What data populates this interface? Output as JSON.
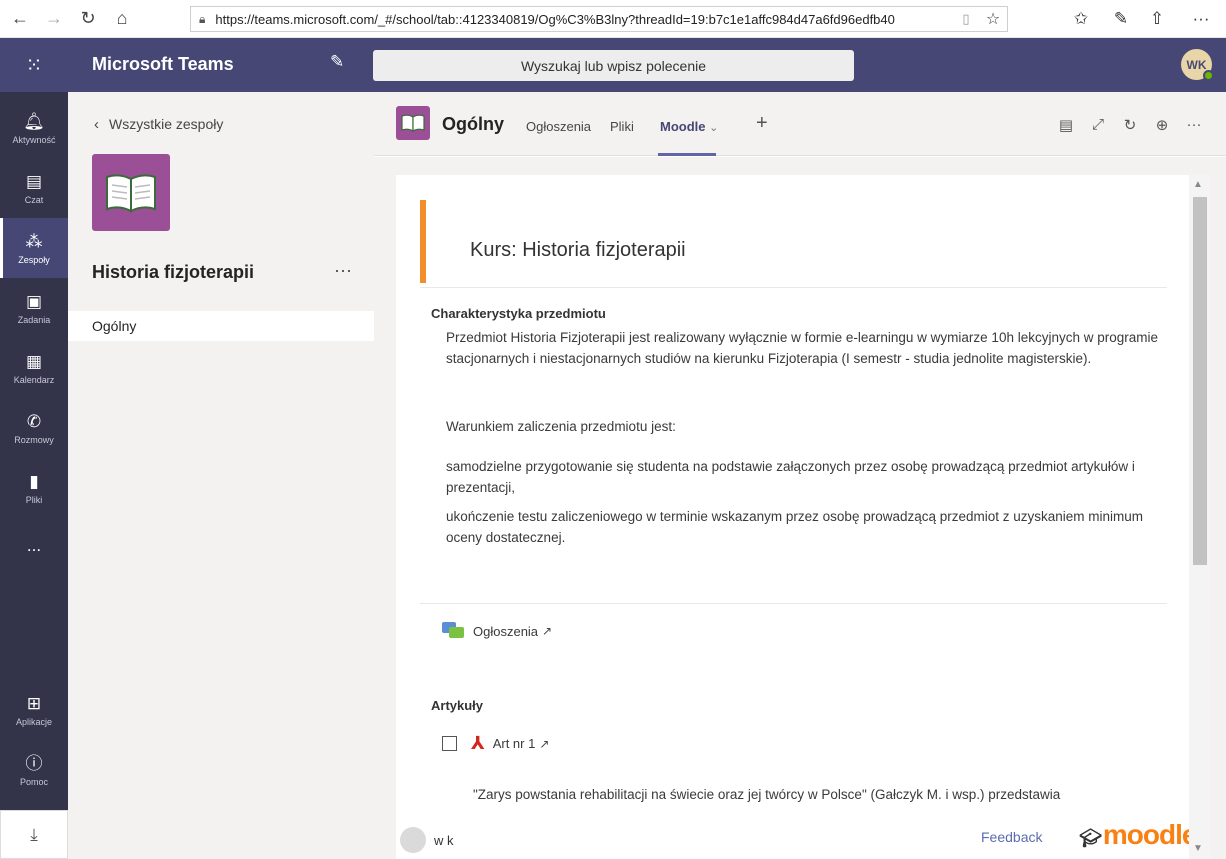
{
  "browser": {
    "url": "https://teams.microsoft.com/_#/school/tab::4123340819/Og%C3%B3lny?threadId=19:b7c1e1affc984d47a6fd96edfb40"
  },
  "topbar": {
    "app_title": "Microsoft Teams",
    "search_placeholder": "Wyszukaj lub wpisz polecenie",
    "avatar_initials": "WK"
  },
  "rail": {
    "items": [
      {
        "label": "Aktywność",
        "icon": "bell-icon"
      },
      {
        "label": "Czat",
        "icon": "chat-icon"
      },
      {
        "label": "Zespoły",
        "icon": "teams-icon"
      },
      {
        "label": "Zadania",
        "icon": "assignments-icon"
      },
      {
        "label": "Kalendarz",
        "icon": "calendar-icon"
      },
      {
        "label": "Rozmowy",
        "icon": "phone-icon"
      },
      {
        "label": "Pliki",
        "icon": "file-icon"
      },
      {
        "label": "Aplikacje",
        "icon": "apps-icon"
      },
      {
        "label": "Pomoc",
        "icon": "help-icon"
      }
    ],
    "more": "..."
  },
  "sidebar": {
    "back_label": "Wszystkie zespoły",
    "team_name": "Historia fizjoterapii",
    "more": "···",
    "channels": [
      {
        "label": "Ogólny"
      }
    ]
  },
  "channel": {
    "name": "Ogólny",
    "tabs": [
      {
        "label": "Ogłoszenia"
      },
      {
        "label": "Pliki"
      },
      {
        "label": "Moodle"
      }
    ],
    "add_tab": "+"
  },
  "course": {
    "title": "Kurs: Historia fizjoterapii",
    "section1_heading": "Charakterystyka przedmiotu",
    "para1": "Przedmiot Historia Fizjoterapii jest realizowany wyłącznie w formie e-learningu w wymiarze 10h lekcyjnych w programie stacjonarnych i niestacjonarnych studiów na kierunku Fizjoterapia (I semestr - studia jednolite magisterskie).",
    "para2": "Warunkiem zaliczenia przedmiotu jest:",
    "para3": "samodzielne przygotowanie się studenta na podstawie załączonych przez osobę prowadzącą przedmiot artykułów i prezentacji,",
    "para4": "ukończenie testu zaliczeniowego w terminie wskazanym przez osobę prowadzącą przedmiot z uzyskaniem minimum oceny dostatecznej.",
    "forum_label": "Ogłoszenia",
    "section2_heading": "Artykuły",
    "article_label": "Art nr 1",
    "article_desc": "\"Zarys powstania rehabilitacji na świecie oraz jej twórcy w Polsce\" (Gałczyk M. i wsp.) przedstawia"
  },
  "footer": {
    "user": "w k",
    "feedback": "Feedback",
    "brand": "moodle"
  },
  "colors": {
    "teams_purple": "#464775",
    "rail_dark": "#33344a",
    "team_tile": "#9b4f96",
    "accent_orange": "#f28d2c",
    "moodle_orange": "#f98012"
  }
}
